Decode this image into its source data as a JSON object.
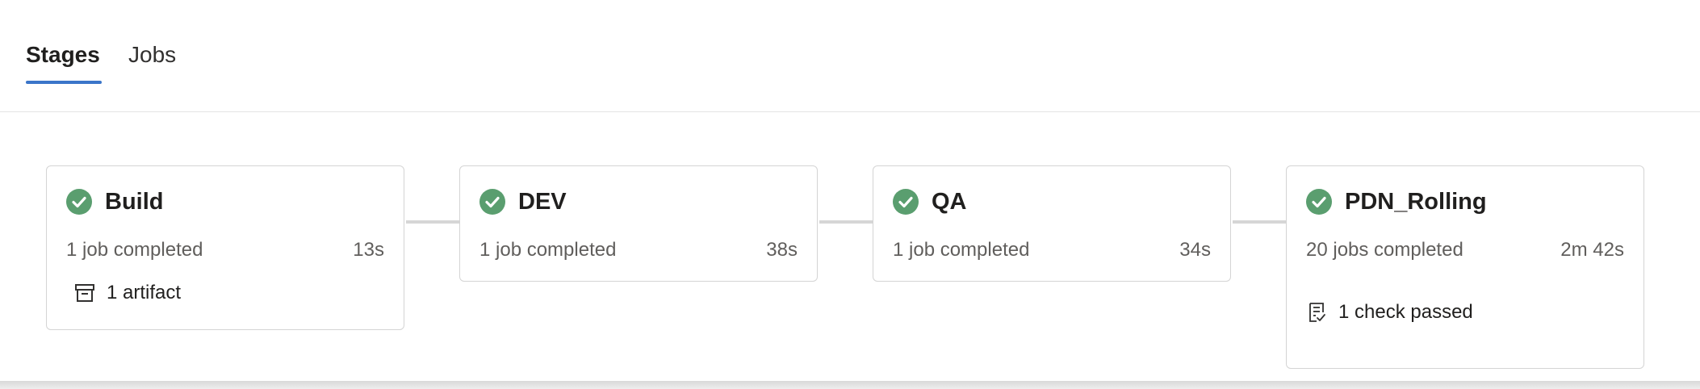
{
  "tabs": [
    {
      "label": "Stages",
      "selected": true
    },
    {
      "label": "Jobs",
      "selected": false
    }
  ],
  "colors": {
    "accent": "#3b75c9",
    "success": "#5a9e6f",
    "border": "#d4d4d4",
    "connector": "#d6d6d6",
    "muted_text": "#605e5c"
  },
  "stages": [
    {
      "name": "Build",
      "status_icon": "success-check-icon",
      "jobs_text": "1 job completed",
      "duration": "13s",
      "extra": {
        "icon": "artifact-icon",
        "text": "1 artifact"
      }
    },
    {
      "name": "DEV",
      "status_icon": "success-check-icon",
      "jobs_text": "1 job completed",
      "duration": "38s"
    },
    {
      "name": "QA",
      "status_icon": "success-check-icon",
      "jobs_text": "1 job completed",
      "duration": "34s"
    },
    {
      "name": "PDN_Rolling",
      "status_icon": "success-check-icon",
      "jobs_text": "20 jobs completed",
      "duration": "2m 42s",
      "extra": {
        "icon": "checklist-icon",
        "text": "1 check passed"
      }
    }
  ]
}
